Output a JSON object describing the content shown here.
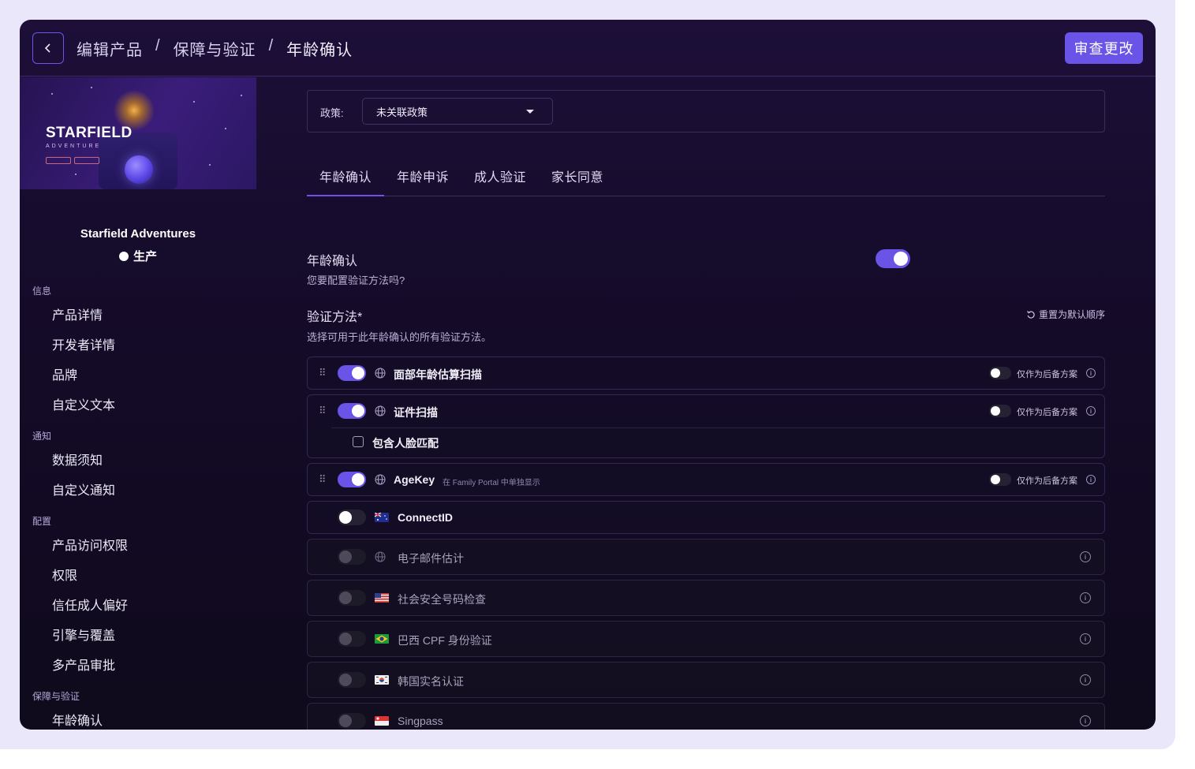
{
  "header": {
    "breadcrumb": [
      "编辑产品",
      "保障与验证",
      "年龄确认"
    ],
    "separator": "/",
    "review_button": "审查更改"
  },
  "sidebar": {
    "banner": {
      "wordmark": "STARFIELD",
      "subtitle": "ADVENTURE"
    },
    "product_name": "Starfield Adventures",
    "status": "生产",
    "sections": [
      {
        "title": "信息",
        "items": [
          "产品详情",
          "开发者详情",
          "品牌",
          "自定义文本"
        ]
      },
      {
        "title": "通知",
        "items": [
          "数据须知",
          "自定义通知"
        ]
      },
      {
        "title": "配置",
        "items": [
          "产品访问权限",
          "权限",
          "信任成人偏好",
          "引擎与覆盖",
          "多产品审批"
        ]
      },
      {
        "title": "保障与验证",
        "items": [
          "年龄确认"
        ]
      }
    ]
  },
  "main": {
    "policy_label": "政策:",
    "policy_value": "未关联政策",
    "tabs": [
      "年龄确认",
      "年龄申诉",
      "成人验证",
      "家长同意"
    ],
    "active_tab": "年龄确认",
    "age_assurance": {
      "title": "年龄确认",
      "description": "您要配置验证方法吗?",
      "enabled": true
    },
    "methods_section": {
      "title": "验证方法*",
      "description": "选择可用于此年龄确认的所有验证方法。",
      "reset_label": "重置为默认顺序"
    },
    "fallback_label": "仅作为后备方案",
    "methods": [
      {
        "label": "面部年龄估算扫描",
        "enabled": true,
        "icon": "globe-icon",
        "fallback": false
      },
      {
        "label": "证件扫描",
        "enabled": true,
        "icon": "globe-icon",
        "fallback": false,
        "option": "包含人脸匹配",
        "option_checked": false
      },
      {
        "label": "AgeKey",
        "note": "在 Family Portal 中单独显示",
        "enabled": true,
        "icon": "globe-icon",
        "fallback": false
      },
      {
        "label": "ConnectID",
        "enabled": false,
        "icon": "australia-flag-icon"
      },
      {
        "label": "电子邮件估计",
        "enabled": false,
        "disabled": true,
        "icon": "globe-icon"
      },
      {
        "label": "社会安全号码检查",
        "enabled": false,
        "disabled": true,
        "icon": "usa-flag-icon"
      },
      {
        "label": "巴西 CPF 身份验证",
        "enabled": false,
        "disabled": true,
        "icon": "brazil-flag-icon"
      },
      {
        "label": "韩国实名认证",
        "enabled": false,
        "disabled": true,
        "icon": "korea-flag-icon"
      },
      {
        "label": "Singpass",
        "enabled": false,
        "disabled": true,
        "icon": "singapore-flag-icon"
      }
    ]
  },
  "colors": {
    "accent": "#6a54e8",
    "background": "#150b29",
    "frame": "#ebe7fb"
  }
}
